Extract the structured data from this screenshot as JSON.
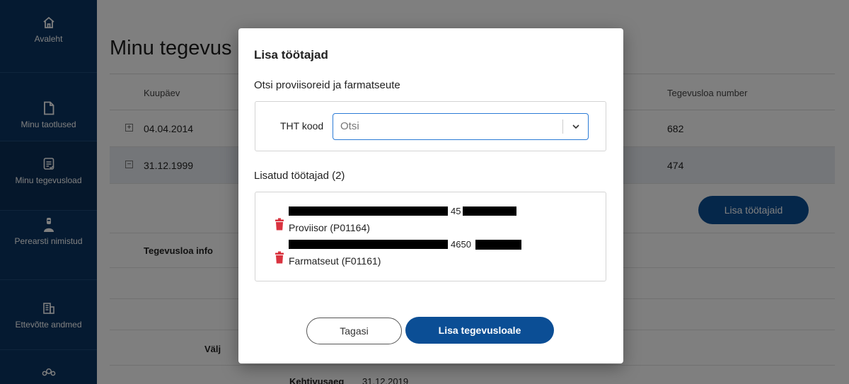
{
  "sidebar": {
    "items": [
      {
        "label": "Avaleht",
        "icon": "home-icon"
      },
      {
        "label": "Minu taotlused",
        "icon": "document-icon"
      },
      {
        "label": "Minu tegevusload",
        "icon": "license-check-icon",
        "active": true
      },
      {
        "label": "Perearsti nimistud",
        "icon": "doctor-icon"
      },
      {
        "label": "Ettevõtte andmed",
        "icon": "building-icon"
      },
      {
        "label": "",
        "icon": "users-icon"
      }
    ]
  },
  "page": {
    "title": "Minu tegevus",
    "table": {
      "col_date": "Kuupäev",
      "col_number": "Tegevusloa number",
      "rows": [
        {
          "date": "04.04.2014",
          "number": "682",
          "toggle": "+"
        },
        {
          "date": "31.12.1999",
          "number": "474",
          "toggle": "−"
        }
      ]
    },
    "add_workers_button": "Lisa töötajaid",
    "info_label": "Tegevusloa info",
    "valj_label": "Välj",
    "validity_label": "Kehtivusaeg",
    "validity_value": "31.12.2019"
  },
  "modal": {
    "title": "Lisa töötajad",
    "search_subtitle": "Otsi proviisoreid ja farmatseute",
    "search_label": "THT kood",
    "search_placeholder": "Otsi",
    "added_title": "Lisatud töötajad (2)",
    "workers": [
      {
        "code_visible": "45",
        "role": "Proviisor (P01164)"
      },
      {
        "code_visible": "4650",
        "role": "Farmatseut (F01161)"
      }
    ],
    "back_button": "Tagasi",
    "add_button": "Lisa tegevusloale"
  },
  "colors": {
    "sidebar": "#0b3562",
    "primary": "#0b4e95",
    "focus": "#2b7bd6",
    "delete": "#d9333f"
  }
}
